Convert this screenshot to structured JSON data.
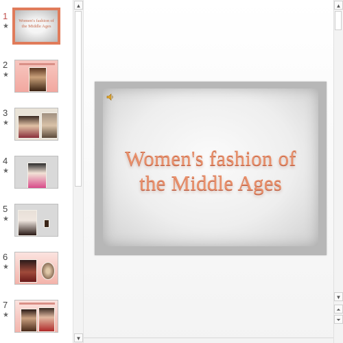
{
  "thumbnails": [
    {
      "number": "1",
      "title_line1": "Women's fashion of",
      "title_line2": "the Middle Ages"
    },
    {
      "number": "2"
    },
    {
      "number": "3"
    },
    {
      "number": "4"
    },
    {
      "number": "5"
    },
    {
      "number": "6"
    },
    {
      "number": "7"
    }
  ],
  "star_glyph": "★",
  "slide": {
    "title_line1": "Women's fashion of",
    "title_line2": "the Middle Ages"
  },
  "colors": {
    "selected_outline": "#e07b5a",
    "title_text": "#e9906a"
  },
  "icons": {
    "scroll_up": "▲",
    "scroll_down": "▼",
    "prev_slide": "⏶",
    "next_slide": "⏷"
  }
}
